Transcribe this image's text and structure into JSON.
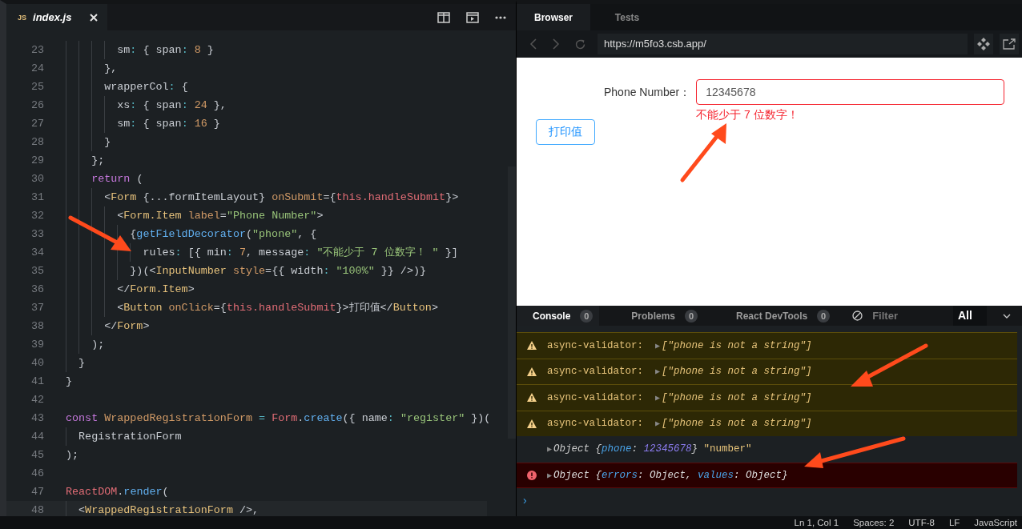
{
  "editor": {
    "tab": {
      "badge": "JS",
      "label": "index.js"
    },
    "lines": [
      {
        "number": "23",
        "tokens": [
          {
            "t": "        sm",
            "kind": "p"
          },
          {
            "t": ":",
            "kind": "c"
          },
          {
            "t": " { span",
            "kind": "p"
          },
          {
            "t": ": ",
            "kind": "c"
          },
          {
            "t": "8",
            "kind": "n"
          },
          {
            "t": " }",
            "kind": "p"
          }
        ]
      },
      {
        "number": "24",
        "tokens": [
          {
            "t": "      },",
            "kind": "p"
          }
        ]
      },
      {
        "number": "25",
        "tokens": [
          {
            "t": "      wrapperCol",
            "kind": "p"
          },
          {
            "t": ":",
            "kind": "c"
          },
          {
            "t": " {",
            "kind": "p"
          }
        ]
      },
      {
        "number": "26",
        "tokens": [
          {
            "t": "        xs",
            "kind": "p"
          },
          {
            "t": ":",
            "kind": "c"
          },
          {
            "t": " { span",
            "kind": "p"
          },
          {
            "t": ": ",
            "kind": "c"
          },
          {
            "t": "24",
            "kind": "n"
          },
          {
            "t": " },",
            "kind": "p"
          }
        ]
      },
      {
        "number": "27",
        "tokens": [
          {
            "t": "        sm",
            "kind": "p"
          },
          {
            "t": ":",
            "kind": "c"
          },
          {
            "t": " { span",
            "kind": "p"
          },
          {
            "t": ": ",
            "kind": "c"
          },
          {
            "t": "16",
            "kind": "n"
          },
          {
            "t": " }",
            "kind": "p"
          }
        ]
      },
      {
        "number": "28",
        "tokens": [
          {
            "t": "      }",
            "kind": "p"
          }
        ]
      },
      {
        "number": "29",
        "tokens": [
          {
            "t": "    };",
            "kind": "p"
          }
        ]
      },
      {
        "number": "30",
        "tokens": [
          {
            "t": "    return",
            "kind": "kw"
          },
          {
            "t": " (",
            "kind": "p"
          }
        ]
      },
      {
        "number": "31",
        "tokens": [
          {
            "t": "      <",
            "kind": "p"
          },
          {
            "t": "Form",
            "kind": "tag"
          },
          {
            "t": " {...formItemLayout} ",
            "kind": "p"
          },
          {
            "t": "onSubmit",
            "kind": "attr"
          },
          {
            "t": "={",
            "kind": "p"
          },
          {
            "t": "this.handleSubmit",
            "kind": "this"
          },
          {
            "t": "}>",
            "kind": "p"
          }
        ]
      },
      {
        "number": "32",
        "tokens": [
          {
            "t": "        <",
            "kind": "p"
          },
          {
            "t": "Form.Item",
            "kind": "tag"
          },
          {
            "t": " label",
            "kind": "attr"
          },
          {
            "t": "=",
            "kind": "p"
          },
          {
            "t": "\"Phone Number\"",
            "kind": "s"
          },
          {
            "t": ">",
            "kind": "p"
          }
        ]
      },
      {
        "number": "33",
        "tokens": [
          {
            "t": "          {",
            "kind": "p"
          },
          {
            "t": "getFieldDecorator",
            "kind": "fn"
          },
          {
            "t": "(",
            "kind": "p"
          },
          {
            "t": "\"phone\"",
            "kind": "s"
          },
          {
            "t": ", {",
            "kind": "p"
          }
        ]
      },
      {
        "number": "34",
        "tokens": [
          {
            "t": "            rules",
            "kind": "p"
          },
          {
            "t": ":",
            "kind": "c"
          },
          {
            "t": " [{ min",
            "kind": "p"
          },
          {
            "t": ": ",
            "kind": "c"
          },
          {
            "t": "7",
            "kind": "n"
          },
          {
            "t": ", message",
            "kind": "p"
          },
          {
            "t": ": ",
            "kind": "c"
          },
          {
            "t": "\"不能少于 7 位数字！ \"",
            "kind": "s"
          },
          {
            "t": " }]",
            "kind": "p"
          }
        ]
      },
      {
        "number": "35",
        "tokens": [
          {
            "t": "          })(<",
            "kind": "p"
          },
          {
            "t": "InputNumber",
            "kind": "tag"
          },
          {
            "t": " style",
            "kind": "attr"
          },
          {
            "t": "={{ width",
            "kind": "p"
          },
          {
            "t": ": ",
            "kind": "c"
          },
          {
            "t": "\"100%\"",
            "kind": "s"
          },
          {
            "t": " }} />)}",
            "kind": "p"
          }
        ]
      },
      {
        "number": "36",
        "tokens": [
          {
            "t": "        </",
            "kind": "p"
          },
          {
            "t": "Form.Item",
            "kind": "tag"
          },
          {
            "t": ">",
            "kind": "p"
          }
        ]
      },
      {
        "number": "37",
        "tokens": [
          {
            "t": "        <",
            "kind": "p"
          },
          {
            "t": "Button",
            "kind": "tag"
          },
          {
            "t": " onClick",
            "kind": "attr"
          },
          {
            "t": "={",
            "kind": "p"
          },
          {
            "t": "this.handleSubmit",
            "kind": "this"
          },
          {
            "t": "}>打印值</",
            "kind": "p"
          },
          {
            "t": "Button",
            "kind": "tag"
          },
          {
            "t": ">",
            "kind": "p"
          }
        ]
      },
      {
        "number": "38",
        "tokens": [
          {
            "t": "      </",
            "kind": "p"
          },
          {
            "t": "Form",
            "kind": "tag"
          },
          {
            "t": ">",
            "kind": "p"
          }
        ]
      },
      {
        "number": "39",
        "tokens": [
          {
            "t": "    );",
            "kind": "p"
          }
        ]
      },
      {
        "number": "40",
        "tokens": [
          {
            "t": "  }",
            "kind": "p"
          }
        ]
      },
      {
        "number": "41",
        "tokens": [
          {
            "t": "}",
            "kind": "p"
          }
        ]
      },
      {
        "number": "42"
      },
      {
        "number": "43",
        "tokens": [
          {
            "t": "const",
            "kind": "kw"
          },
          {
            "t": " WrappedRegistrationForm",
            "kind": "attr"
          },
          {
            "t": " =",
            "kind": "c"
          },
          {
            "t": " Form",
            "kind": "this"
          },
          {
            "t": ".",
            "kind": "p"
          },
          {
            "t": "create",
            "kind": "fn"
          },
          {
            "t": "({ name",
            "kind": "p"
          },
          {
            "t": ": ",
            "kind": "c"
          },
          {
            "t": "\"register\"",
            "kind": "s"
          },
          {
            "t": " })(",
            "kind": "p"
          }
        ]
      },
      {
        "number": "44",
        "tokens": [
          {
            "t": "  RegistrationForm",
            "kind": "p"
          }
        ]
      },
      {
        "number": "45",
        "tokens": [
          {
            "t": ");",
            "kind": "p"
          }
        ]
      },
      {
        "number": "46"
      },
      {
        "number": "47",
        "tokens": [
          {
            "t": "ReactDOM",
            "kind": "this"
          },
          {
            "t": ".",
            "kind": "p"
          },
          {
            "t": "render",
            "kind": "fn"
          },
          {
            "t": "(",
            "kind": "p"
          }
        ]
      },
      {
        "number": "48",
        "current": true,
        "tokens": [
          {
            "t": "  <",
            "kind": "p"
          },
          {
            "t": "WrappedRegistrationForm",
            "kind": "tag"
          },
          {
            "t": " />,",
            "kind": "p"
          }
        ]
      }
    ]
  },
  "browser": {
    "tabs": [
      {
        "label": "Browser",
        "selected": true
      },
      {
        "label": "Tests",
        "selected": false
      }
    ],
    "url": "https://m5fo3.csb.app/",
    "page": {
      "label": "Phone Number：",
      "field": {
        "value": "12345678",
        "error": true
      },
      "error_message": "不能少于 7 位数字！",
      "button": "打印值"
    }
  },
  "console": {
    "tabs": [
      {
        "label": "Console",
        "count": "0",
        "selected": true
      },
      {
        "label": "Problems",
        "count": "0",
        "selected": false
      },
      {
        "label": "React DevTools",
        "count": "0",
        "selected": false
      }
    ],
    "filter": {
      "placeholder": "Filter"
    },
    "level": "All",
    "logs": [
      {
        "kind": "warning",
        "tokens": [
          {
            "t": "async-validator:  ",
            "kind": "label"
          },
          {
            "t": "▶",
            "kind": "exp"
          },
          {
            "t": "[\"phone is not a string\"]",
            "kind": "it"
          }
        ]
      },
      {
        "kind": "warning",
        "tokens": [
          {
            "t": "async-validator:  ",
            "kind": "label"
          },
          {
            "t": "▶",
            "kind": "exp"
          },
          {
            "t": "[\"phone is not a string\"]",
            "kind": "it"
          }
        ]
      },
      {
        "kind": "warning",
        "tokens": [
          {
            "t": "async-validator:  ",
            "kind": "label"
          },
          {
            "t": "▶",
            "kind": "exp"
          },
          {
            "t": "[\"phone is not a string\"]",
            "kind": "it"
          }
        ]
      },
      {
        "kind": "warning",
        "tokens": [
          {
            "t": "async-validator:  ",
            "kind": "label"
          },
          {
            "t": "▶",
            "kind": "exp"
          },
          {
            "t": "[\"phone is not a string\"]",
            "kind": "it"
          }
        ]
      },
      {
        "kind": "log",
        "tokens": [
          {
            "t": "▶",
            "kind": "exp"
          },
          {
            "t": "Object {",
            "kind": "it"
          },
          {
            "t": "phone",
            "kind": "key"
          },
          {
            "t": ": ",
            "kind": "it"
          },
          {
            "t": "12345678",
            "kind": "num"
          },
          {
            "t": "}",
            "kind": "it"
          },
          {
            "t": " \"number\"",
            "kind": "str"
          }
        ]
      },
      {
        "kind": "error",
        "tokens": [
          {
            "t": "▶",
            "kind": "exp"
          },
          {
            "t": "Object {",
            "kind": "it"
          },
          {
            "t": "errors",
            "kind": "key"
          },
          {
            "t": ": Object, ",
            "kind": "it"
          },
          {
            "t": "values",
            "kind": "key"
          },
          {
            "t": ": Object}",
            "kind": "it"
          }
        ]
      }
    ],
    "prompt": "›"
  },
  "status_bar": [
    "Ln 1, Col 1",
    "Spaces: 2",
    "UTF-8",
    "LF",
    "JavaScript"
  ]
}
